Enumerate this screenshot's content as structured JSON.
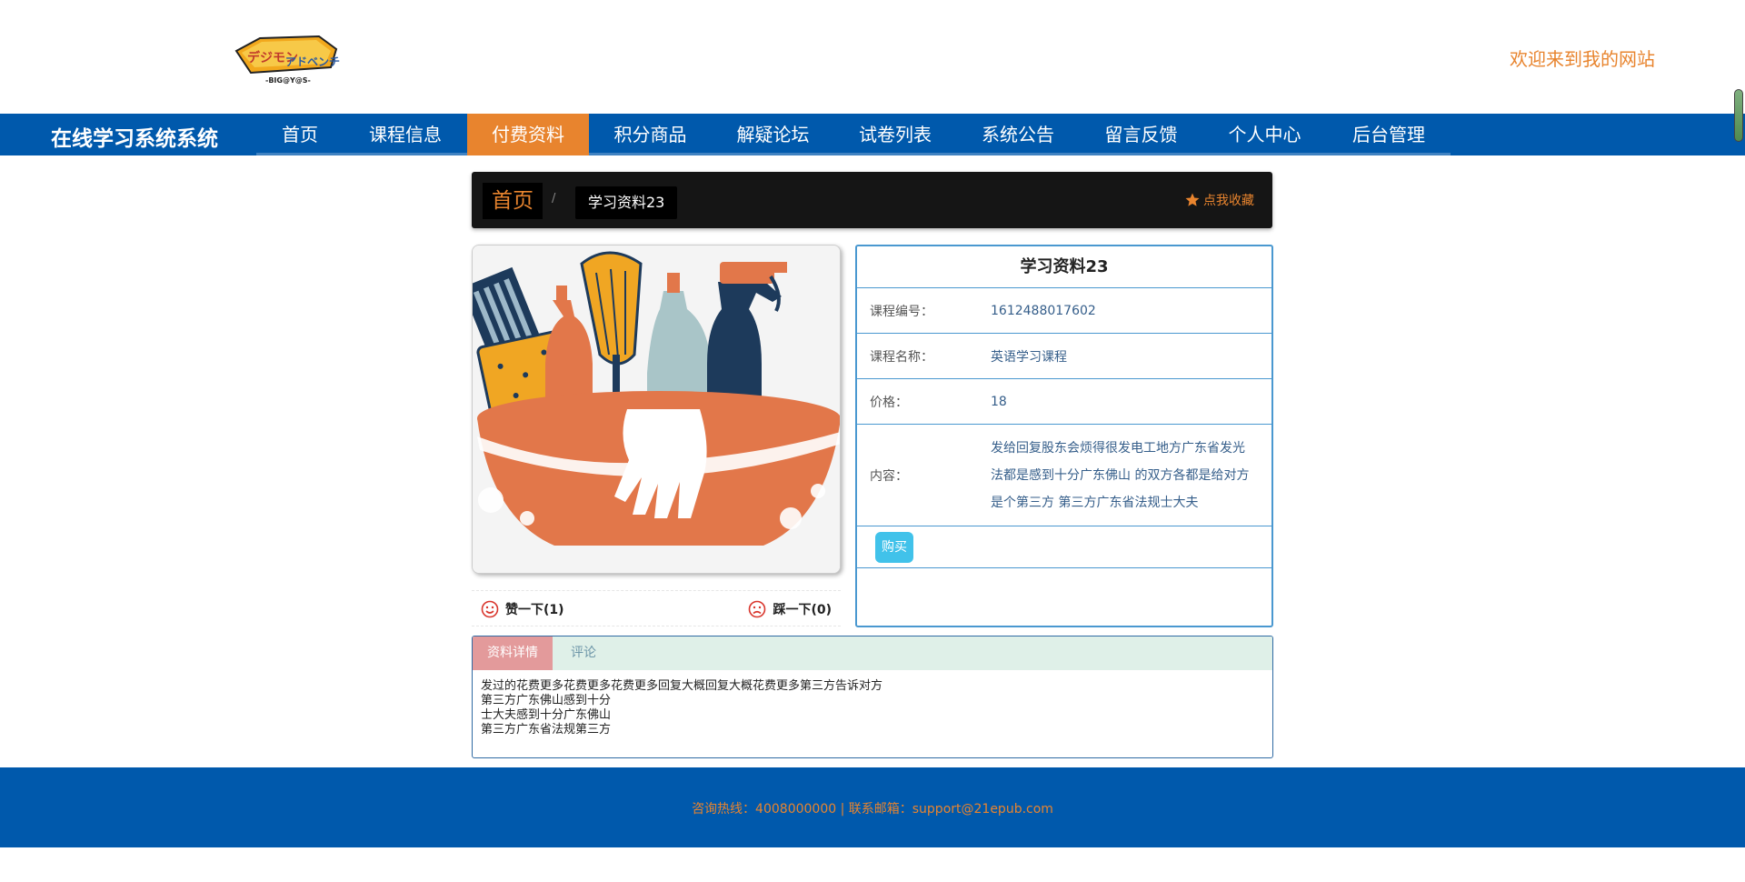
{
  "header": {
    "welcome": "欢迎来到我的网站",
    "logo_icon": "digimon-adventure-logo"
  },
  "nav": {
    "site_title": "在线学习系统系统",
    "items": [
      {
        "label": "首页"
      },
      {
        "label": "课程信息"
      },
      {
        "label": "付费资料",
        "active": true
      },
      {
        "label": "积分商品"
      },
      {
        "label": "解疑论坛"
      },
      {
        "label": "试卷列表"
      },
      {
        "label": "系统公告"
      },
      {
        "label": "留言反馈"
      },
      {
        "label": "个人中心"
      },
      {
        "label": "后台管理"
      }
    ],
    "bg_color": "#0059ac",
    "active_color": "#e8842e"
  },
  "breadcrumb": {
    "home": "首页",
    "separator": "/",
    "current": "学习资料23",
    "favorite": "点我收藏",
    "favorite_icon": "star-icon"
  },
  "image": {
    "icon": "cleaning-supplies-basin-illustration"
  },
  "votes": {
    "up_label": "赞一下(1)",
    "up_icon": "smile-icon",
    "down_label": "踩一下(0)",
    "down_icon": "frown-icon"
  },
  "info": {
    "title": "学习资料23",
    "rows": [
      {
        "label": "课程编号：",
        "value": "1612488017602"
      },
      {
        "label": "课程名称：",
        "value": "英语学习课程"
      },
      {
        "label": "价格：",
        "value": "18"
      },
      {
        "label": "内容：",
        "value": "发给回复股东会烦得很发电工地方广东省发光法都是感到十分广东佛山 的双方各都是给对方是个第三方 第三方广东省法规士大夫"
      }
    ],
    "buy_label": "购买"
  },
  "tabs": {
    "detail_label": "资料详情",
    "comment_label": "评论",
    "detail_lines": [
      "发过的花费更多花费更多花费更多回复大概回复大概花费更多第三方告诉对方",
      "第三方广东佛山感到十分",
      "士大夫感到十分广东佛山",
      "第三方广东省法规第三方"
    ]
  },
  "footer": {
    "text": "咨询热线：4008000000 | 联系邮箱：support@21epub.com"
  }
}
